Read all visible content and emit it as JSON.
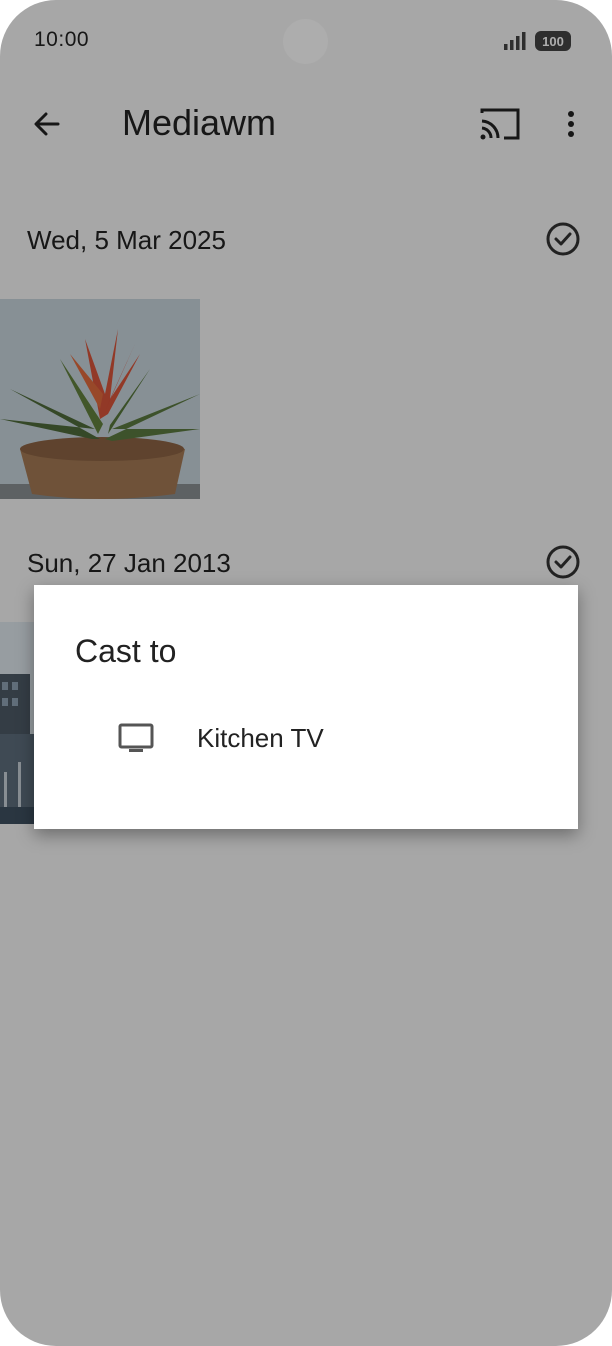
{
  "status_bar": {
    "time": "10:00",
    "battery": "100"
  },
  "app_bar": {
    "title": "Mediawm",
    "back_icon": "arrow-back-icon",
    "cast_icon": "cast-icon",
    "more_icon": "more-vert-icon"
  },
  "sections": [
    {
      "date": "Wed, 5 Mar 2025"
    },
    {
      "date": "Sun, 27 Jan 2013"
    }
  ],
  "dialog": {
    "title": "Cast to",
    "devices": [
      {
        "label": "Kitchen TV",
        "icon": "tv-icon"
      }
    ]
  },
  "colors": {
    "text": "#222222",
    "dialog_bg": "#ffffff",
    "scrim": "rgba(0,0,0,0.32)"
  }
}
